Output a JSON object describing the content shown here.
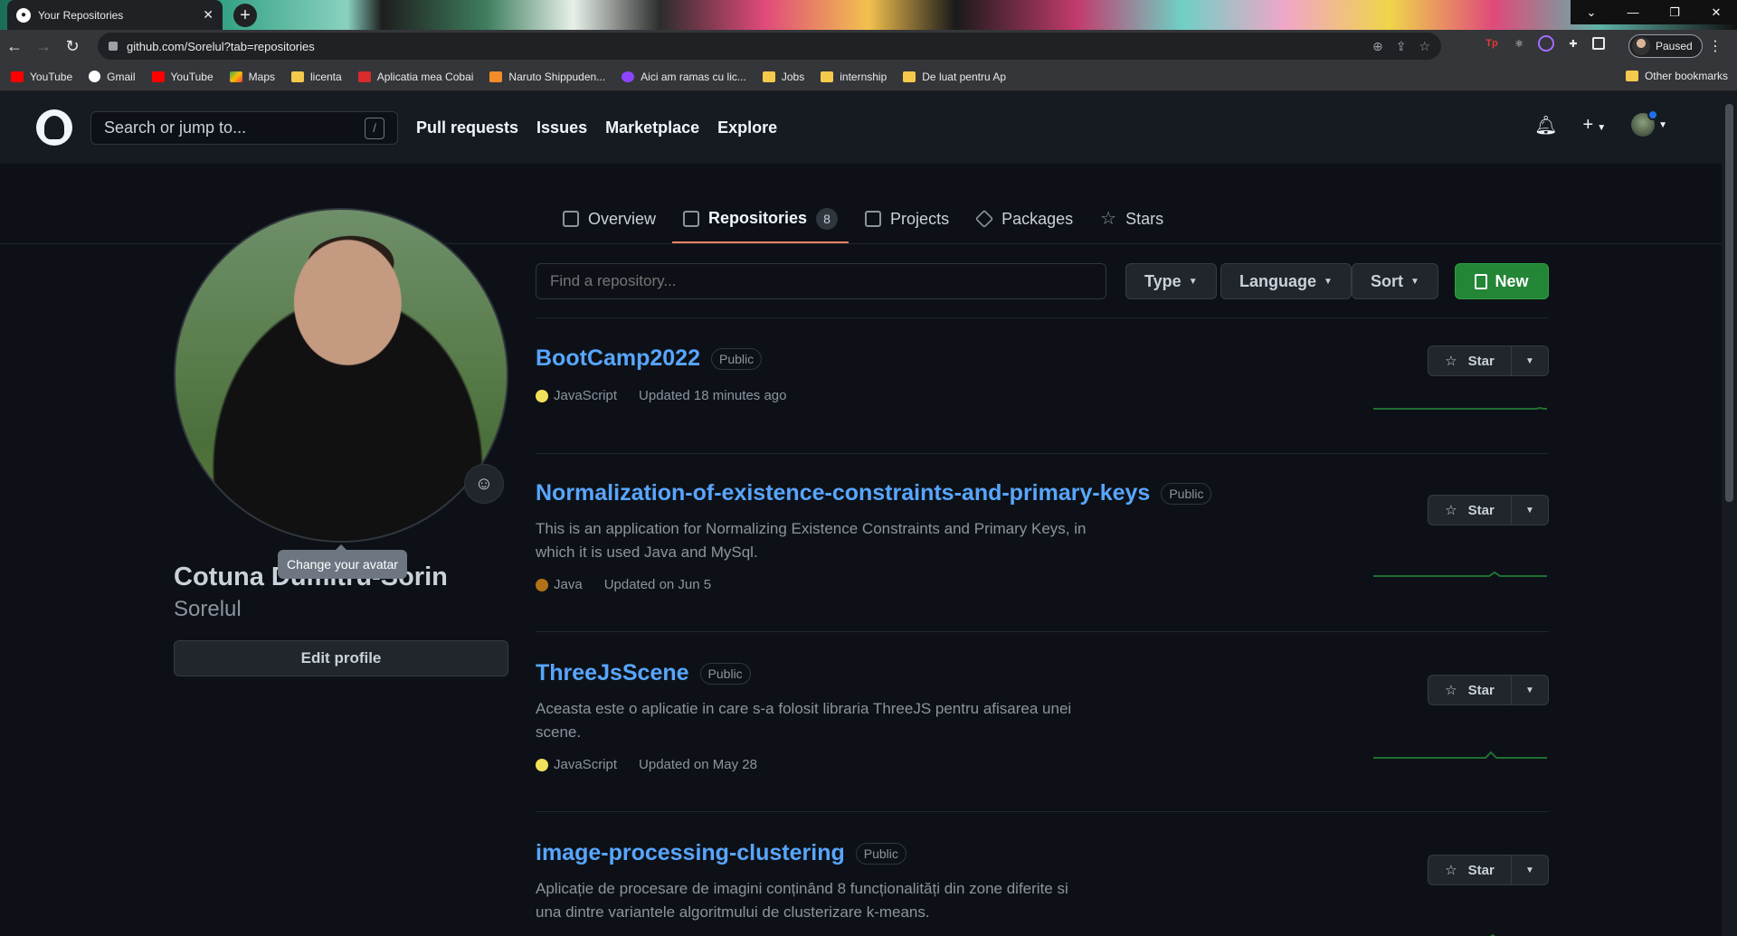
{
  "browser": {
    "tab_title": "Your Repositories",
    "tab_close": "✕",
    "new_tab": "+",
    "url": "github.com/Sorelul?tab=repositories",
    "profile_status": "Paused",
    "window": {
      "minimize": "—",
      "restore": "❐",
      "close": "✕",
      "tabsearch": "⌄"
    },
    "bookmarks": [
      {
        "label": "YouTube",
        "icon": "yt"
      },
      {
        "label": "Gmail",
        "icon": "g"
      },
      {
        "label": "YouTube",
        "icon": "yt"
      },
      {
        "label": "Maps",
        "icon": "maps"
      },
      {
        "label": "licenta",
        "icon": "folder"
      },
      {
        "label": "Aplicatia mea Cobai",
        "icon": "a"
      },
      {
        "label": "Naruto Shippuden...",
        "icon": "f"
      },
      {
        "label": "Aici am ramas cu lic...",
        "icon": "v"
      },
      {
        "label": "Jobs",
        "icon": "folder"
      },
      {
        "label": "internship",
        "icon": "folder"
      },
      {
        "label": "De luat pentru Ap",
        "icon": "folder"
      }
    ],
    "other_bookmarks": "Other bookmarks"
  },
  "gh_header": {
    "search_placeholder": "Search or jump to...",
    "slash_key": "/",
    "nav": [
      "Pull requests",
      "Issues",
      "Marketplace",
      "Explore"
    ],
    "plus": "+"
  },
  "profile_tabs": {
    "overview": "Overview",
    "repositories": "Repositories",
    "repo_count": "8",
    "projects": "Projects",
    "packages": "Packages",
    "stars": "Stars"
  },
  "profile": {
    "full_name": "Cotuna Dumitru-Sorin",
    "username": "Sorelul",
    "edit_button": "Edit profile",
    "tooltip": "Change your avatar",
    "emoji": "☺"
  },
  "filters": {
    "find_placeholder": "Find a repository...",
    "type": "Type",
    "language": "Language",
    "sort": "Sort",
    "new": "New"
  },
  "repos": [
    {
      "name": "BootCamp2022",
      "visibility": "Public",
      "description": "",
      "language": "JavaScript",
      "language_color": "#f1e05a",
      "updated": "Updated 18 minutes ago",
      "star_label": "Star"
    },
    {
      "name": "Normalization-of-existence-constraints-and-primary-keys",
      "visibility": "Public",
      "description": "This is an application for Normalizing Existence Constraints and Primary Keys, in which it is used Java and MySql.",
      "language": "Java",
      "language_color": "#b07219",
      "updated": "Updated on Jun 5",
      "star_label": "Star"
    },
    {
      "name": "ThreeJsScene",
      "visibility": "Public",
      "description": "Aceasta este o aplicatie in care s-a folosit libraria ThreeJS pentru afisarea unei scene.",
      "language": "JavaScript",
      "language_color": "#f1e05a",
      "updated": "Updated on May 28",
      "star_label": "Star"
    },
    {
      "name": "image-processing-clustering",
      "visibility": "Public",
      "description": "Aplicație de procesare de imagini conținând 8 funcționalități din zone diferite si una dintre variantele algoritmului de clusterizare k-means.",
      "language": "",
      "language_color": "",
      "updated": "",
      "star_label": "Star"
    }
  ]
}
